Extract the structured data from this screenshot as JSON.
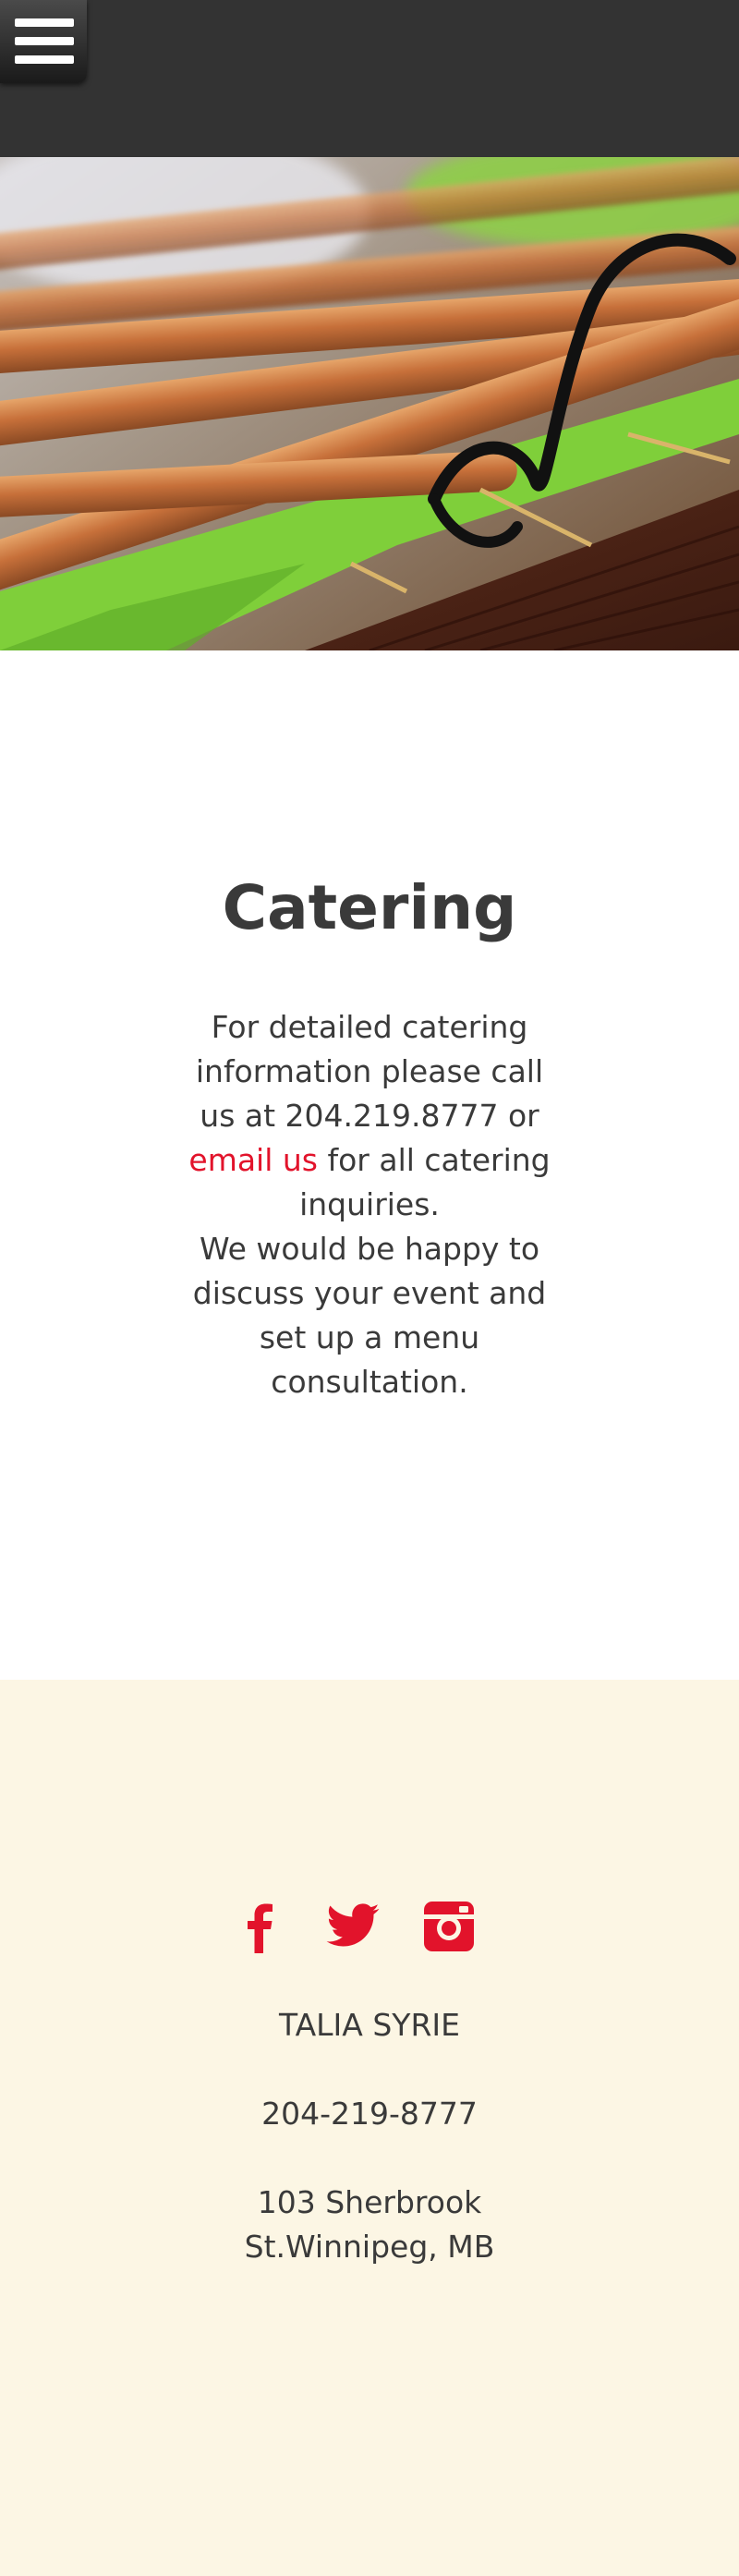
{
  "header": {
    "menu_icon": "hamburger-menu-icon"
  },
  "hero": {
    "image": "breadsticks-in-wicker-basket-photo"
  },
  "main": {
    "title": "Catering",
    "text_before_phone": "For detailed catering information please call us at ",
    "phone": "204.219.8777",
    "text_or": " or ",
    "email_link": "email us",
    "text_after_link": " for all catering inquiries.",
    "text_second": "We would be happy to discuss your event and set up a menu consultation."
  },
  "footer": {
    "social": [
      {
        "icon": "facebook-icon"
      },
      {
        "icon": "twitter-icon"
      },
      {
        "icon": "instagram-icon"
      }
    ],
    "name": "TALIA SYRIE",
    "phone": "204-219-8777",
    "address_line1": "103 Sherbrook",
    "address_line2": "St.Winnipeg, MB"
  },
  "colors": {
    "topbar": "#333333",
    "accent_red": "#e2132b",
    "footer_bg": "#fcf6e4",
    "text": "#3a3a3a"
  }
}
